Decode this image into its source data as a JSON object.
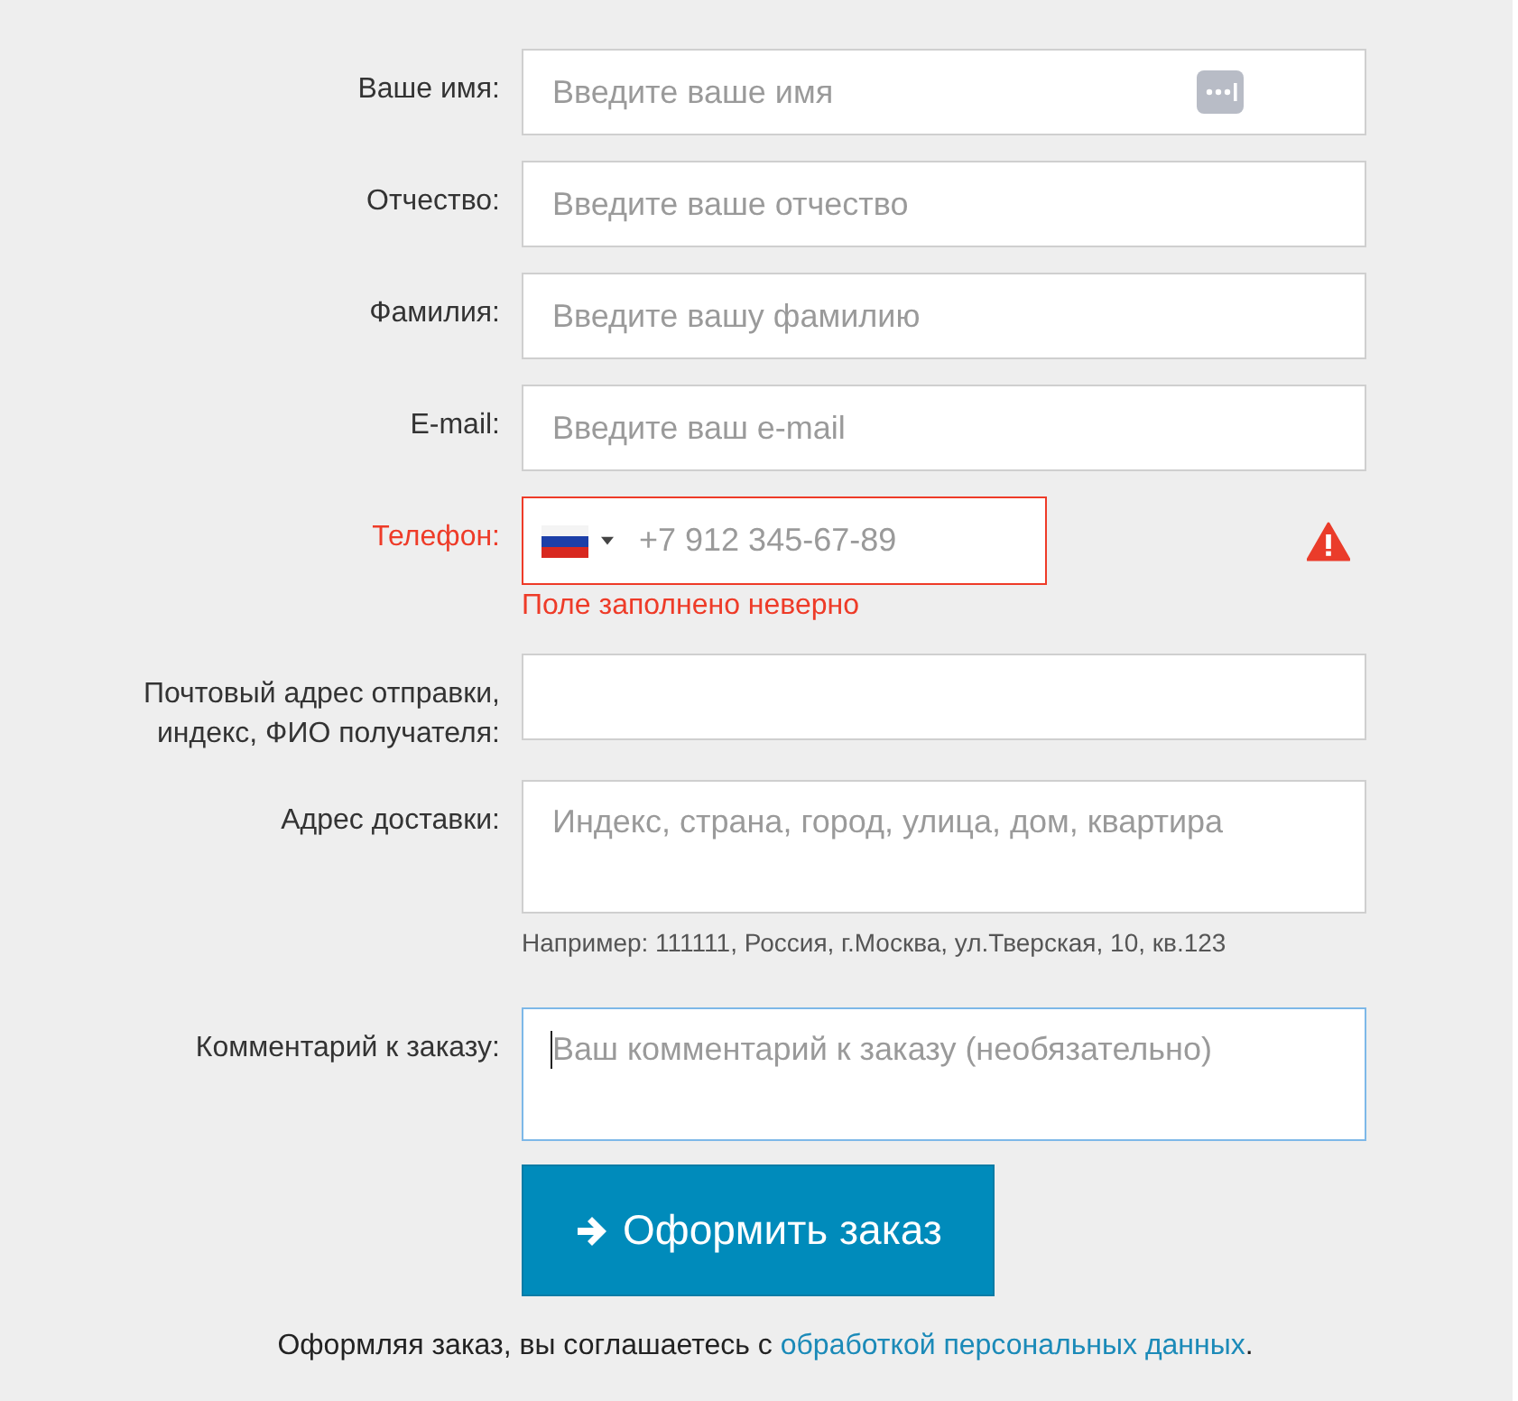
{
  "fields": [
    {
      "kind": "text",
      "label": "Ваше имя:",
      "placeholder": "Введите ваше имя",
      "autofill": true,
      "invalid": false,
      "focused": false
    },
    {
      "kind": "text",
      "label": "Отчество:",
      "placeholder": "Введите ваше отчество",
      "autofill": false,
      "invalid": false,
      "focused": false
    },
    {
      "kind": "text",
      "label": "Фамилия:",
      "placeholder": "Введите вашу фамилию",
      "autofill": false,
      "invalid": false,
      "focused": false
    },
    {
      "kind": "text",
      "label": "E-mail:",
      "placeholder": "Введите ваш e-mail",
      "autofill": false,
      "invalid": false,
      "focused": false
    },
    {
      "kind": "phone",
      "label": "Телефон:",
      "placeholder": "+7 912 345-67-89",
      "invalid": true,
      "focused": false,
      "error": "Поле заполнено неверно"
    },
    {
      "kind": "text",
      "label": "Почтовый адрес отправки,\nиндекс, ФИО получателя:",
      "autofill": false,
      "invalid": false,
      "focused": false
    },
    {
      "kind": "textarea",
      "label": "Адрес доставки:",
      "placeholder": "Индекс, страна, город, улица, дом, квартира",
      "invalid": false,
      "focused": false,
      "hint": "Например: 111111, Россия, г.Москва, ул.Тверская, 10, кв.123"
    },
    {
      "kind": "textarea",
      "label": "Комментарий к заказу:",
      "placeholder": "Ваш комментарий к заказу (необязательно)",
      "invalid": false,
      "focused": true
    }
  ],
  "submit": {
    "label": "Оформить заказ"
  },
  "consent": {
    "text": "Оформляя заказ, вы соглашаетесь с ",
    "link": "обработкой персональных данных",
    "end": "."
  }
}
